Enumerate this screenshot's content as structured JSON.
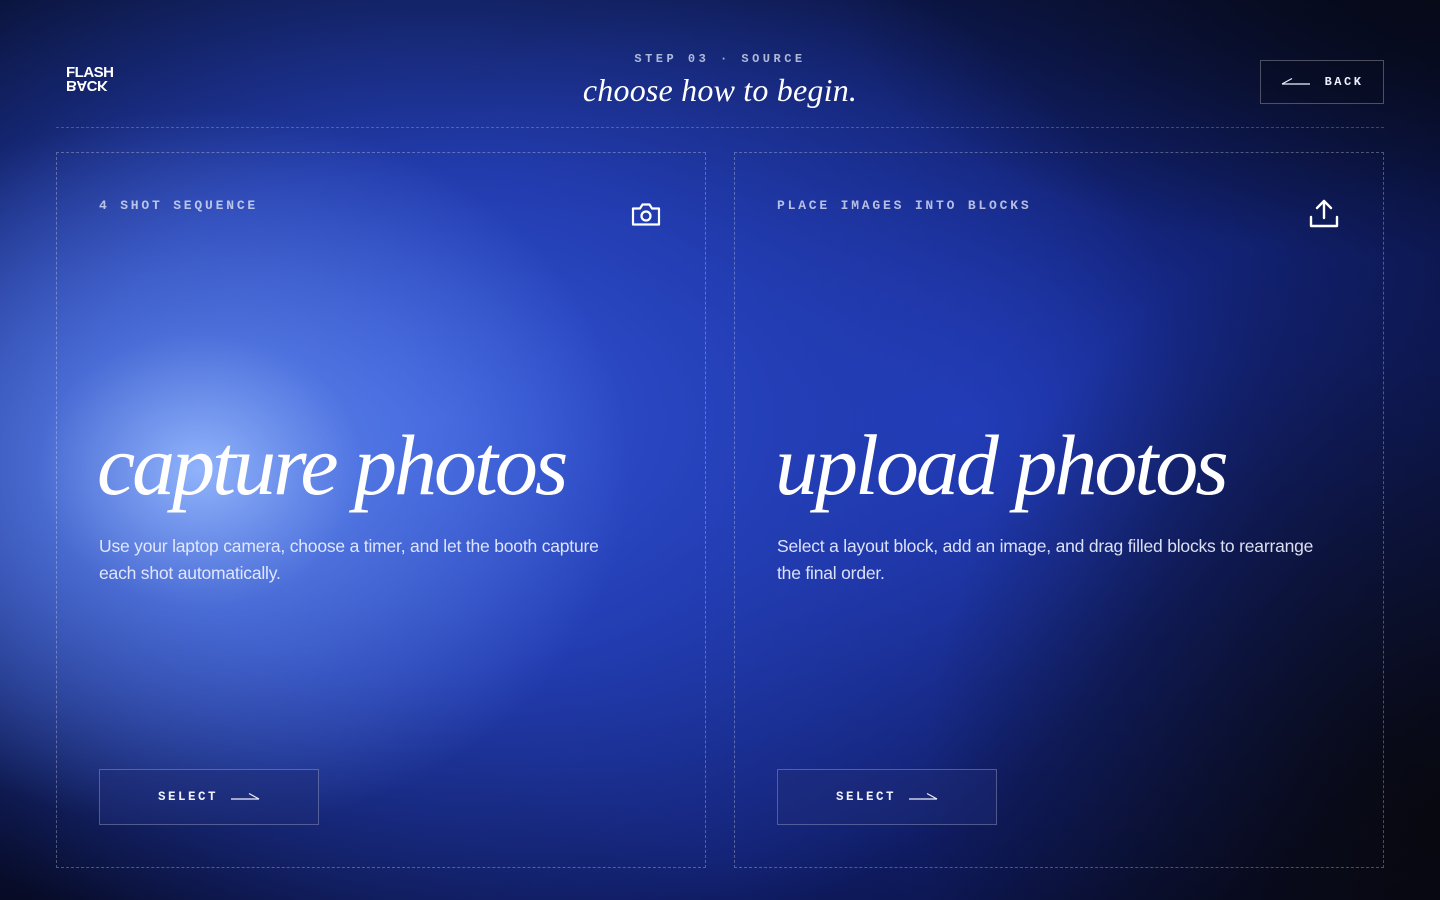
{
  "brand": {
    "logo_top": "FLASH",
    "logo_bottom": "BACK"
  },
  "header": {
    "step_label": "STEP 03 · SOURCE",
    "title": "choose how to begin.",
    "back_label": "BACK"
  },
  "cards": [
    {
      "eyebrow": "4 SHOT SEQUENCE",
      "icon": "camera-icon",
      "title": "capture photos",
      "description": "Use your laptop camera, choose a timer, and let the booth capture each shot automatically.",
      "button_label": "SELECT"
    },
    {
      "eyebrow": "PLACE IMAGES INTO BLOCKS",
      "icon": "upload-icon",
      "title": "upload photos",
      "description": "Select a layout block, add an image, and drag filled blocks to rearrange the final order.",
      "button_label": "SELECT"
    }
  ],
  "colors": {
    "background_deep": "#081030",
    "accent_blue": "#3456d6",
    "highlight_blue": "#96b9ff",
    "text": "#ffffff"
  }
}
